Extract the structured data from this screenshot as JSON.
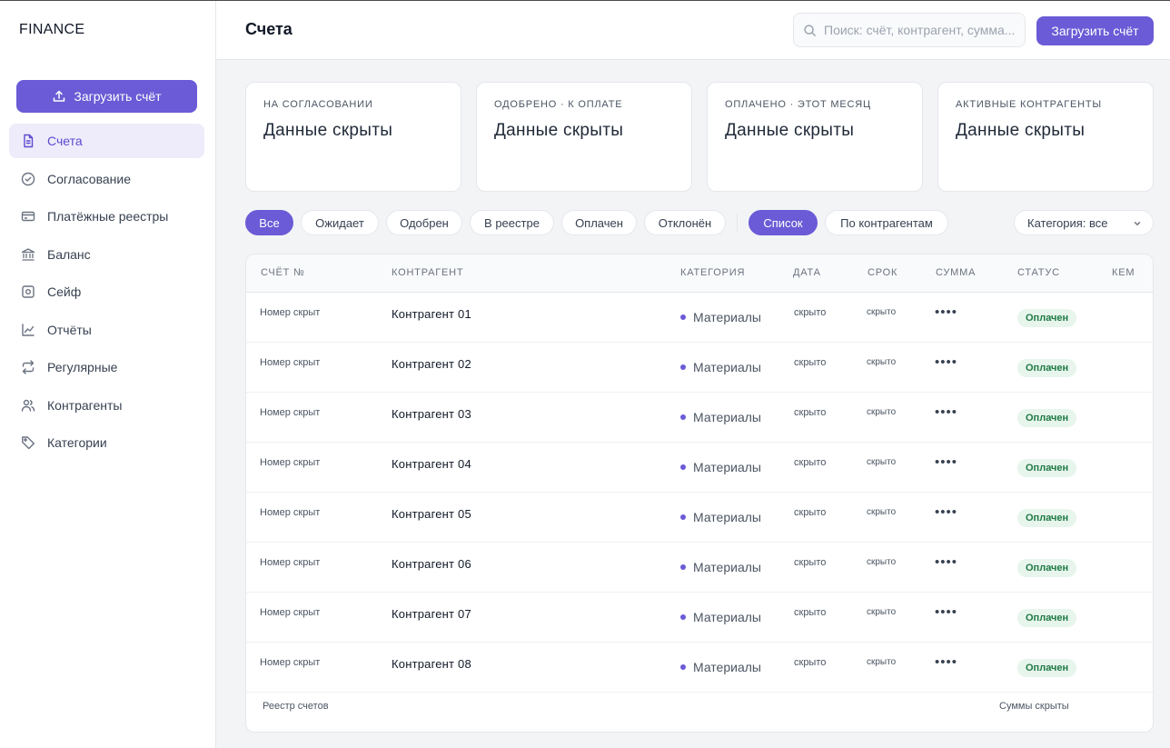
{
  "app": {
    "brand": "FINANCE"
  },
  "sidebar": {
    "upload_label": "Загрузить счёт",
    "items": [
      {
        "label": "Счета",
        "icon": "document-icon",
        "active": true
      },
      {
        "label": "Согласование",
        "icon": "check-circle-icon"
      },
      {
        "label": "Платёжные реестры",
        "icon": "card-icon"
      },
      {
        "label": "Баланс",
        "icon": "bank-icon"
      },
      {
        "label": "Сейф",
        "icon": "safe-icon"
      },
      {
        "label": "Отчёты",
        "icon": "chart-icon"
      },
      {
        "label": "Регулярные",
        "icon": "repeat-icon"
      },
      {
        "label": "Контрагенты",
        "icon": "users-icon"
      },
      {
        "label": "Категории",
        "icon": "tag-icon"
      }
    ]
  },
  "header": {
    "title": "Счета",
    "search_placeholder": "Поиск: счёт, контрагент, сумма...",
    "upload_label": "Загрузить счёт"
  },
  "stats": [
    {
      "label": "НА СОГЛАСОВАНИИ",
      "value": "Данные скрыты"
    },
    {
      "label": "ОДОБРЕНО · К ОПЛАТЕ",
      "value": "Данные скрыты"
    },
    {
      "label": "ОПЛАЧЕНО · ЭТОТ МЕСЯЦ",
      "value": "Данные скрыты"
    },
    {
      "label": "АКТИВНЫЕ КОНТРАГЕНТЫ",
      "value": "Данные скрыты"
    }
  ],
  "filters": {
    "status_chips": [
      "Все",
      "Ожидает",
      "Одобрен",
      "В реестре",
      "Оплачен",
      "Отклонён"
    ],
    "active_status": "Все",
    "view_chips": [
      "Список",
      "По контрагентам"
    ],
    "active_view": "Список",
    "category_select": "Категория: все"
  },
  "table": {
    "columns": [
      "СЧЁТ №",
      "КОНТРАГЕНТ",
      "КАТЕГОРИЯ",
      "ДАТА",
      "СРОК",
      "СУММА",
      "СТАТУС",
      "КЕМ"
    ],
    "rows": [
      {
        "number": "Номер скрыт",
        "contractor": "Контрагент 01",
        "category": "Материалы",
        "date": "скрыто",
        "due": "скрыто",
        "sum": "••••",
        "status": "Оплачен"
      },
      {
        "number": "Номер скрыт",
        "contractor": "Контрагент 02",
        "category": "Материалы",
        "date": "скрыто",
        "due": "скрыто",
        "sum": "••••",
        "status": "Оплачен"
      },
      {
        "number": "Номер скрыт",
        "contractor": "Контрагент 03",
        "category": "Материалы",
        "date": "скрыто",
        "due": "скрыто",
        "sum": "••••",
        "status": "Оплачен"
      },
      {
        "number": "Номер скрыт",
        "contractor": "Контрагент 04",
        "category": "Материалы",
        "date": "скрыто",
        "due": "скрыто",
        "sum": "••••",
        "status": "Оплачен"
      },
      {
        "number": "Номер скрыт",
        "contractor": "Контрагент 05",
        "category": "Материалы",
        "date": "скрыто",
        "due": "скрыто",
        "sum": "••••",
        "status": "Оплачен"
      },
      {
        "number": "Номер скрыт",
        "contractor": "Контрагент 06",
        "category": "Материалы",
        "date": "скрыто",
        "due": "скрыто",
        "sum": "••••",
        "status": "Оплачен"
      },
      {
        "number": "Номер скрыт",
        "contractor": "Контрагент 07",
        "category": "Материалы",
        "date": "скрыто",
        "due": "скрыто",
        "sum": "••••",
        "status": "Оплачен"
      },
      {
        "number": "Номер скрыт",
        "contractor": "Контрагент 08",
        "category": "Материалы",
        "date": "скрыто",
        "due": "скрыто",
        "sum": "••••",
        "status": "Оплачен"
      }
    ],
    "footer_left": "Реестр счетов",
    "footer_right": "Суммы скрыты"
  },
  "colors": {
    "accent": "#6b5bd6",
    "status_paid_bg": "#e7f5ec",
    "status_paid_text": "#1f7a44"
  }
}
